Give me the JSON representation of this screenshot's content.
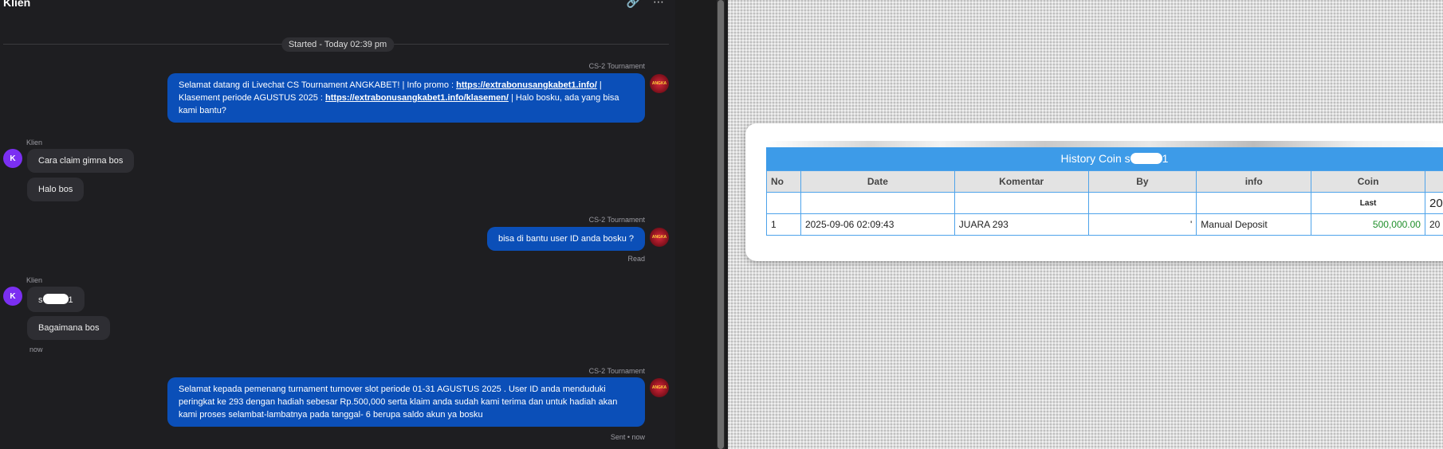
{
  "chat": {
    "title": "Klien",
    "header_icons": [
      "link-icon",
      "more-icon"
    ],
    "started_label": "Started - Today 02:39 pm",
    "messages": {
      "m1": {
        "sender": "CS-2 Tournament",
        "avatar_text": "ANGKA",
        "part1": "Selamat datang di Livechat CS Tournament ANGKABET! | Info promo : ",
        "link1": "https://extrabonusangkabet1.info/",
        "part2": " | Klasement periode AGUSTUS 2025 : ",
        "link2": "https://extrabonusangkabet1.info/klasemen/",
        "part3": " | Halo bosku, ada yang bisa kami bantu?"
      },
      "m2": {
        "sender": "Klien",
        "avatar": "K",
        "line1": "Cara claim gimna bos",
        "line2": "Halo bos"
      },
      "m3": {
        "sender": "CS-2 Tournament",
        "avatar_text": "ANGKA",
        "text": "bisa di bantu user ID anda bosku ?",
        "status": "Read"
      },
      "m4": {
        "sender": "Klien",
        "avatar": "K",
        "line1_start": "s",
        "line1_end": "1",
        "line2": "Bagaimana bos",
        "time": "now"
      },
      "m5": {
        "sender": "CS-2 Tournament",
        "avatar_text": "ANGKA",
        "text": "Selamat kepada pemenang turnament turnover slot periode 01-31 AGUSTUS 2025 . User ID anda menduduki peringkat ke 293 dengan hadiah sebesar Rp.500,000 serta klaim anda sudah kami terima dan untuk hadiah akan kami proses selambat-lambatnya pada tanggal- 6 berupa saldo akun ya bosku",
        "status": "Sent • now"
      }
    }
  },
  "history": {
    "title_prefix": "History Coin s",
    "title_suffix": "1",
    "headers": {
      "no": "No",
      "date": "Date",
      "komentar": "Komentar",
      "by": "By",
      "info": "info",
      "coin": "Coin"
    },
    "last_label": "Last",
    "last_value_partial": "20",
    "row1": {
      "no": "1",
      "date": "2025-09-06 02:09:43",
      "komentar": "JUARA 293",
      "by": "'",
      "info": "Manual Deposit",
      "coin": "500,000.00",
      "extra": "20"
    }
  },
  "colors": {
    "chat_bg": "#1e1e21",
    "outgoing_bubble": "#0b4fb8",
    "incoming_bubble": "#2e2e33",
    "avatar_k": "#7b2ff2",
    "table_header": "#3d9be8",
    "coin_amount": "#1f8f2a"
  }
}
